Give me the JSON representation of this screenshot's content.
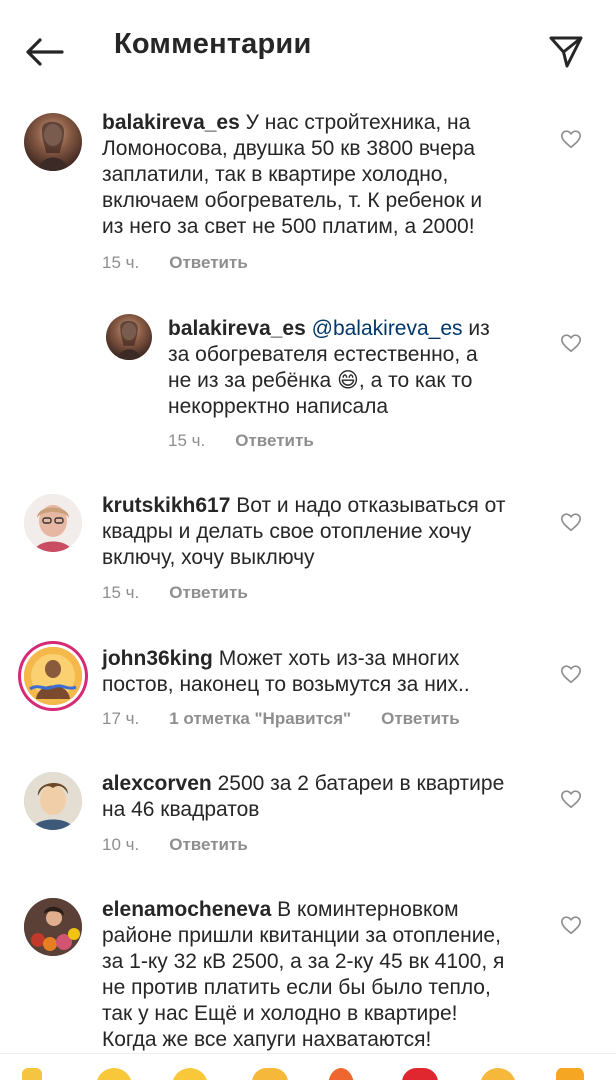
{
  "header": {
    "title": "Комментарии"
  },
  "comments": [
    {
      "username": "balakireva_es",
      "text": " У нас стройтехника, на\nЛомоносова, двушка 50 кв 3800 вчера\nзаплатили, так в квартире холодно,\nвключаем обогреватель, т. К ребенок и\nиз него за свет не 500 платим, а 2000!",
      "time": "15 ч.",
      "reply": "Ответить"
    },
    {
      "username": "balakireva_es",
      "mention": " @balakireva_es",
      "text": " из\nза обогревателя естественно, а\nне из за ребёнка 😄, а то как то\nнекорректно написала",
      "time": "15 ч.",
      "reply": "Ответить"
    },
    {
      "username": "krutskikh617",
      "text": " Вот и надо отказываться от\nквадры и делать свое отопление хочу\nвключу, хочу выключу",
      "time": "15 ч.",
      "reply": "Ответить"
    },
    {
      "username": "john36king",
      "text": " Может хоть из-за многих\nпостов, наконец то возьмутся за них..",
      "time": "17 ч.",
      "likes": "1 отметка \"Нравится\"",
      "reply": "Ответить"
    },
    {
      "username": "alexcorven",
      "text": " 2500 за 2 батареи в квартире\nна 46 квадратов",
      "time": "10 ч.",
      "reply": "Ответить"
    },
    {
      "username": "elenamocheneva",
      "text": " В коминтерновком\nрайоне пришли квитанции за отопление,\nза 1-ку 32 кВ 2500, а за 2-ку 45 вк 4100, я\nне против платить если бы  было тепло,\nтак у нас Ещё и холодно в квартире!\nКогда же все хапуги нахватаются!"
    }
  ],
  "colors": {
    "text": "#262626",
    "secondary": "#8e8e8e",
    "mention": "#00376b",
    "story_ring": "#d62976"
  },
  "icons": {
    "back": "arrow-left-icon",
    "send": "send-icon",
    "like": "heart-outline-icon"
  }
}
